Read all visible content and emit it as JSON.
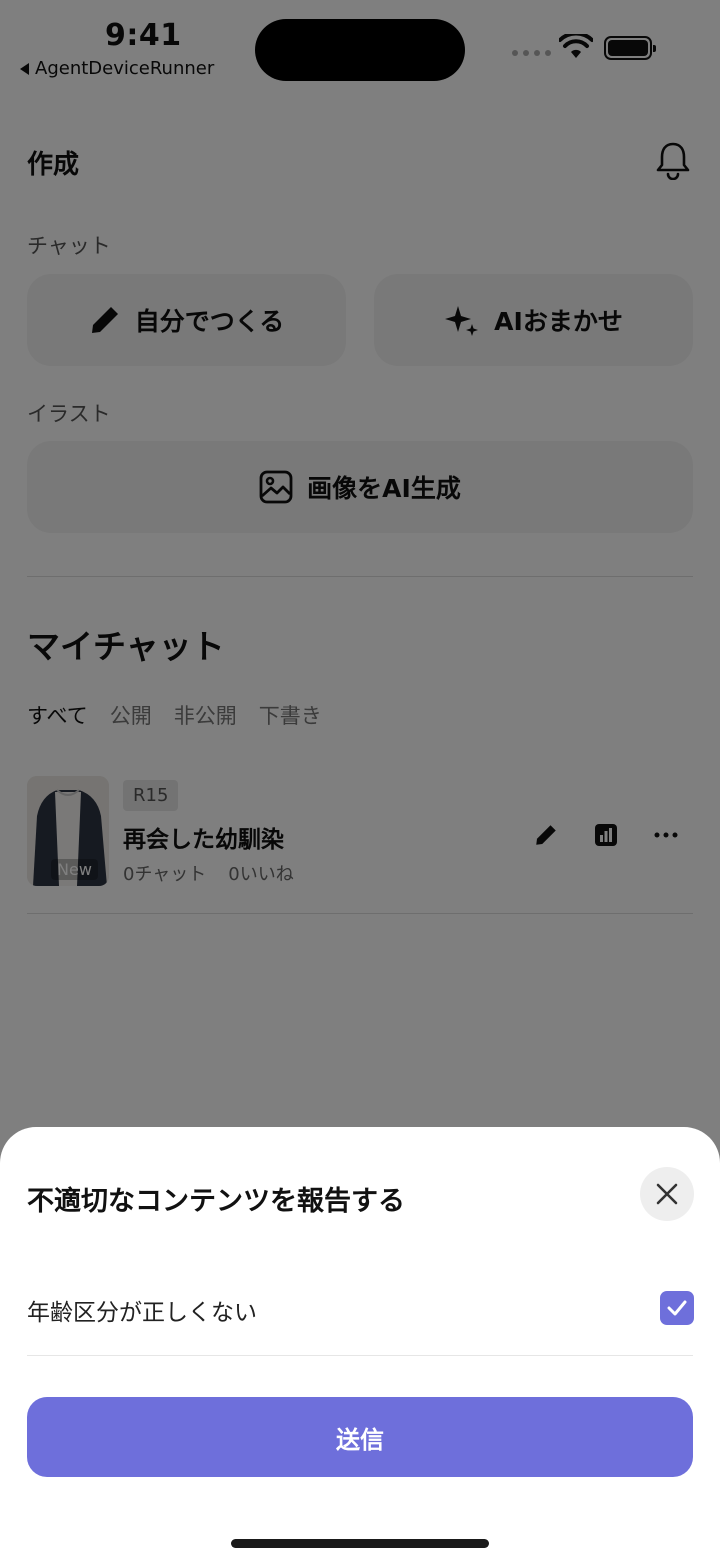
{
  "status_bar": {
    "time": "9:41",
    "back_app": "AgentDeviceRunner"
  },
  "header": {
    "title": "作成",
    "icon": "bell-icon"
  },
  "chat_section": {
    "label": "チャット",
    "manual_button": "自分でつくる",
    "ai_button": "AIおまかせ"
  },
  "illust_section": {
    "label": "イラスト",
    "generate_button": "画像をAI生成"
  },
  "my_chats": {
    "title": "マイチャット",
    "filters": [
      "すべて",
      "公開",
      "非公開",
      "下書き"
    ],
    "items": [
      {
        "rating": "R15",
        "name": "再会した幼馴染",
        "chats": "0チャット",
        "likes": "0いいね",
        "thumb_label": "New"
      }
    ]
  },
  "report_sheet": {
    "title": "不適切なコンテンツを報告する",
    "reason": "年齢区分が正しくない",
    "reason_checked": true,
    "submit_label": "送信",
    "accent": "#6e6fdb"
  }
}
